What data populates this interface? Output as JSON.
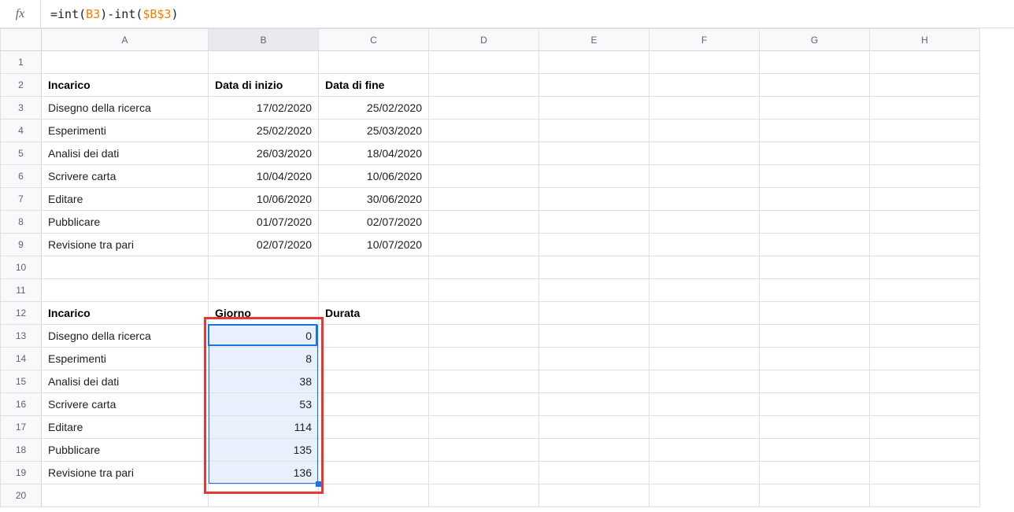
{
  "formula_bar": {
    "fx_label": "fx",
    "eq": "=",
    "fn": "int",
    "lp": "(",
    "rp": ")",
    "ref1": "B3",
    "minus": "-",
    "ref2": "$B$3"
  },
  "columns": [
    "A",
    "B",
    "C",
    "D",
    "E",
    "F",
    "G",
    "H"
  ],
  "row_count": 20,
  "cells": {
    "A2": {
      "v": "Incarico",
      "bold": true
    },
    "B2": {
      "v": "Data di inizio",
      "bold": true
    },
    "C2": {
      "v": "Data di fine",
      "bold": true
    },
    "A3": {
      "v": "Disegno della ricerca"
    },
    "B3": {
      "v": "17/02/2020",
      "num": true
    },
    "C3": {
      "v": "25/02/2020",
      "num": true
    },
    "A4": {
      "v": "Esperimenti"
    },
    "B4": {
      "v": "25/02/2020",
      "num": true
    },
    "C4": {
      "v": "25/03/2020",
      "num": true
    },
    "A5": {
      "v": "Analisi dei dati"
    },
    "B5": {
      "v": "26/03/2020",
      "num": true
    },
    "C5": {
      "v": "18/04/2020",
      "num": true
    },
    "A6": {
      "v": "Scrivere carta"
    },
    "B6": {
      "v": "10/04/2020",
      "num": true
    },
    "C6": {
      "v": "10/06/2020",
      "num": true
    },
    "A7": {
      "v": "Editare"
    },
    "B7": {
      "v": "10/06/2020",
      "num": true
    },
    "C7": {
      "v": "30/06/2020",
      "num": true
    },
    "A8": {
      "v": "Pubblicare"
    },
    "B8": {
      "v": "01/07/2020",
      "num": true
    },
    "C8": {
      "v": "02/07/2020",
      "num": true
    },
    "A9": {
      "v": "Revisione tra pari"
    },
    "B9": {
      "v": "02/07/2020",
      "num": true
    },
    "C9": {
      "v": "10/07/2020",
      "num": true
    },
    "A12": {
      "v": "Incarico",
      "bold": true
    },
    "B12": {
      "v": "Giorno",
      "bold": true
    },
    "C12": {
      "v": "Durata",
      "bold": true
    },
    "A13": {
      "v": "Disegno della ricerca"
    },
    "B13": {
      "v": "0",
      "num": true
    },
    "A14": {
      "v": "Esperimenti"
    },
    "B14": {
      "v": "8",
      "num": true
    },
    "A15": {
      "v": "Analisi dei dati"
    },
    "B15": {
      "v": "38",
      "num": true
    },
    "A16": {
      "v": "Scrivere carta"
    },
    "B16": {
      "v": "53",
      "num": true
    },
    "A17": {
      "v": "Editare"
    },
    "B17": {
      "v": "114",
      "num": true
    },
    "A18": {
      "v": "Pubblicare"
    },
    "B18": {
      "v": "135",
      "num": true
    },
    "A19": {
      "v": "Revisione tra pari"
    },
    "B19": {
      "v": "136",
      "num": true
    }
  },
  "selection": {
    "active": "B13",
    "range_start": "B13",
    "range_end": "B19"
  },
  "chart_data": {
    "type": "table",
    "tables": [
      {
        "title": "Date incarichi",
        "columns": [
          "Incarico",
          "Data di inizio",
          "Data di fine"
        ],
        "rows": [
          [
            "Disegno della ricerca",
            "17/02/2020",
            "25/02/2020"
          ],
          [
            "Esperimenti",
            "25/02/2020",
            "25/03/2020"
          ],
          [
            "Analisi dei dati",
            "26/03/2020",
            "18/04/2020"
          ],
          [
            "Scrivere carta",
            "10/04/2020",
            "10/06/2020"
          ],
          [
            "Editare",
            "10/06/2020",
            "30/06/2020"
          ],
          [
            "Pubblicare",
            "01/07/2020",
            "02/07/2020"
          ],
          [
            "Revisione tra pari",
            "02/07/2020",
            "10/07/2020"
          ]
        ]
      },
      {
        "title": "Giorni",
        "columns": [
          "Incarico",
          "Giorno",
          "Durata"
        ],
        "rows": [
          [
            "Disegno della ricerca",
            0,
            null
          ],
          [
            "Esperimenti",
            8,
            null
          ],
          [
            "Analisi dei dati",
            38,
            null
          ],
          [
            "Scrivere carta",
            53,
            null
          ],
          [
            "Editare",
            114,
            null
          ],
          [
            "Pubblicare",
            135,
            null
          ],
          [
            "Revisione tra pari",
            136,
            null
          ]
        ]
      }
    ]
  }
}
